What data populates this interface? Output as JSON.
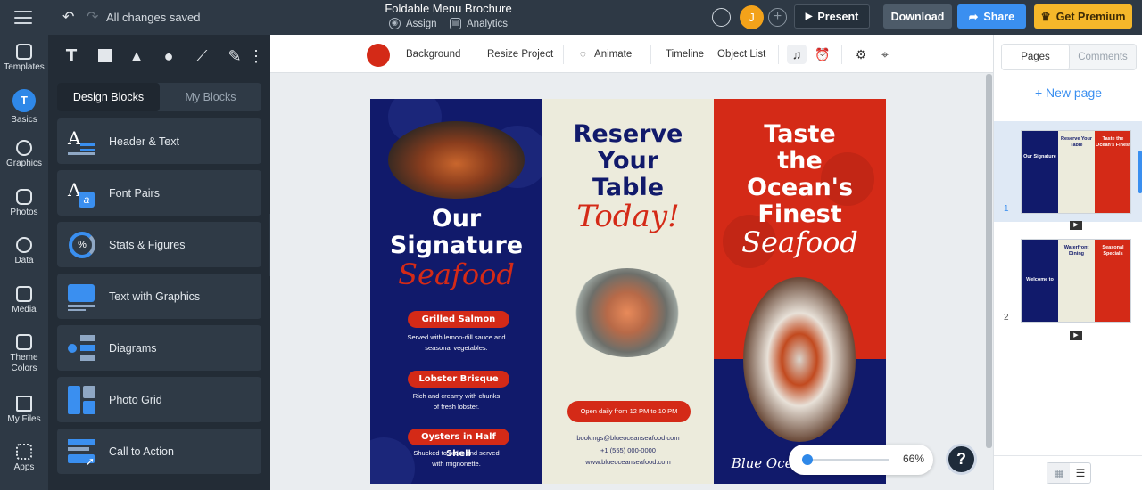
{
  "topbar": {
    "save_status": "All changes saved",
    "project_title": "Foldable Menu Brochure",
    "assign_label": "Assign",
    "analytics_label": "Analytics",
    "avatar_initial": "J",
    "present_label": "Present",
    "download_label": "Download",
    "share_label": "Share",
    "premium_label": "Get Premium"
  },
  "rail": [
    {
      "label": "Templates",
      "icon": "templates-icon"
    },
    {
      "label": "Basics",
      "icon": "basics-icon",
      "glyph": "T"
    },
    {
      "label": "Graphics",
      "icon": "graphics-icon"
    },
    {
      "label": "Photos",
      "icon": "photos-icon"
    },
    {
      "label": "Data",
      "icon": "data-icon"
    },
    {
      "label": "Media",
      "icon": "media-icon"
    },
    {
      "label": "Theme Colors",
      "icon": "theme-colors-icon"
    },
    {
      "label": "My Files",
      "icon": "my-files-icon"
    },
    {
      "label": "Apps",
      "icon": "apps-icon"
    }
  ],
  "panel": {
    "tools": {
      "text": "T"
    },
    "tabs": {
      "design_blocks": "Design Blocks",
      "my_blocks": "My Blocks"
    },
    "blocks": [
      {
        "label": "Header & Text",
        "icon": "header-text-icon"
      },
      {
        "label": "Font Pairs",
        "icon": "font-pairs-icon"
      },
      {
        "label": "Stats & Figures",
        "icon": "stats-figures-icon"
      },
      {
        "label": "Text with Graphics",
        "icon": "text-graphics-icon"
      },
      {
        "label": "Diagrams",
        "icon": "diagrams-icon"
      },
      {
        "label": "Photo Grid",
        "icon": "photo-grid-icon"
      },
      {
        "label": "Call to Action",
        "icon": "call-to-action-icon"
      }
    ]
  },
  "toolbar": {
    "background": "Background",
    "resize": "Resize Project",
    "animate": "Animate",
    "timeline": "Timeline",
    "object_list": "Object List",
    "background_color": "#d42a17"
  },
  "brochure": {
    "left": {
      "heading1": "Our",
      "heading2": "Signature",
      "script": "Seafood",
      "items": [
        {
          "name": "Grilled Salmon",
          "desc1": "Served with lemon-dill sauce and",
          "desc2": "seasonal vegetables."
        },
        {
          "name": "Lobster Brisque",
          "desc1": "Rich and creamy with chunks",
          "desc2": "of fresh lobster."
        },
        {
          "name": "Oysters in Half Shell",
          "desc1": "Shucked to order and served",
          "desc2": "with mignonette."
        }
      ]
    },
    "middle": {
      "heading1": "Reserve",
      "heading2": "Your",
      "heading3": "Table",
      "script": "Today!",
      "hours": "Open daily from 12 PM to 10 PM",
      "email": "bookings@blueoceanseafood.com",
      "phone": "+1 (555) 000-0000",
      "web": "www.blueoceanseafood.com"
    },
    "right": {
      "heading1": "Taste",
      "heading2": "the",
      "heading3": "Ocean's",
      "heading4": "Finest",
      "script": "Seafood",
      "brand": "Blue Ocean Seafood"
    },
    "colors": {
      "navy": "#111a6b",
      "red": "#d42a17",
      "cream": "#ecebdc"
    }
  },
  "right_panel": {
    "tab_pages": "Pages",
    "tab_comments": "Comments",
    "new_page": "+ New page",
    "pages": [
      {
        "number": "1",
        "mini_left": "Our Signature",
        "mini_mid": "Reserve Your Table",
        "mini_right": "Taste the Ocean's Finest"
      },
      {
        "number": "2",
        "mini_left": "Welcome to",
        "mini_mid": "Waterfront Dining",
        "mini_right": "Seasonal Specials"
      }
    ]
  },
  "zoom": {
    "value": "66%",
    "level": 0.66
  },
  "help": "?"
}
